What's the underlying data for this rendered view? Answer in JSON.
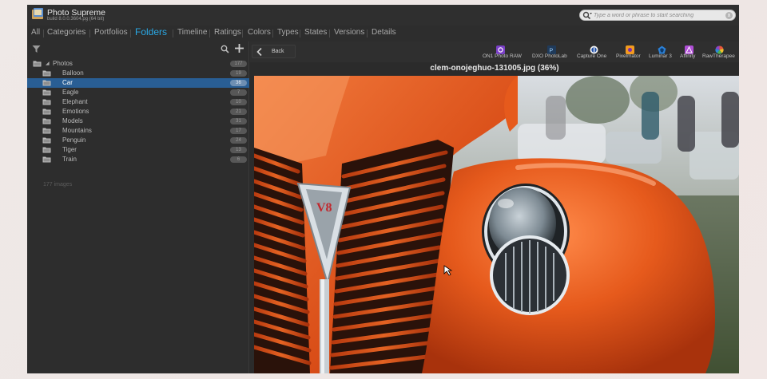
{
  "app": {
    "title": "Photo Supreme",
    "build": "build 8.0.0.3604.pg (64 bit)"
  },
  "search": {
    "placeholder": "Type a word or phrase to start searching",
    "clear_label": "x"
  },
  "tabs": [
    {
      "label": "All",
      "active": false
    },
    {
      "label": "Categories",
      "active": false
    },
    {
      "label": "Portfolios",
      "active": false
    },
    {
      "label": "Folders",
      "active": true
    },
    {
      "label": "Timeline",
      "active": false
    },
    {
      "label": "Ratings",
      "active": false
    },
    {
      "label": "Colors",
      "active": false
    },
    {
      "label": "Types",
      "active": false
    },
    {
      "label": "States",
      "active": false
    },
    {
      "label": "Versions",
      "active": false
    },
    {
      "label": "Details",
      "active": false
    }
  ],
  "folders": {
    "root": {
      "label": "Photos",
      "count": "177",
      "expander": "◢"
    },
    "items": [
      {
        "label": "Balloon",
        "count": "19",
        "selected": false
      },
      {
        "label": "Car",
        "count": "36",
        "selected": true
      },
      {
        "label": "Eagle",
        "count": "7",
        "selected": false
      },
      {
        "label": "Elephant",
        "count": "10",
        "selected": false
      },
      {
        "label": "Emotions",
        "count": "21",
        "selected": false
      },
      {
        "label": "Models",
        "count": "31",
        "selected": false
      },
      {
        "label": "Mountains",
        "count": "17",
        "selected": false
      },
      {
        "label": "Penguin",
        "count": "24",
        "selected": false
      },
      {
        "label": "Tiger",
        "count": "13",
        "selected": false
      },
      {
        "label": "Train",
        "count": "6",
        "selected": false
      }
    ],
    "status": "177 images"
  },
  "viewer": {
    "back_label": "Back",
    "image_title": "clem-onojeghuo-131005.jpg (36%)"
  },
  "plugins": [
    {
      "label": "ON1 Photo RAW",
      "color": "#7a3fc6"
    },
    {
      "label": "DXO PhotoLab",
      "color": "#1f3a5a"
    },
    {
      "label": "Capture One",
      "color": "#f0f0f0"
    },
    {
      "label": "Pixelmator",
      "color": "#f29a1f"
    },
    {
      "label": "Luminar 3",
      "color": "#2b80d6"
    },
    {
      "label": "Affinity",
      "color": "#b04fd6"
    },
    {
      "label": "RawTherapee",
      "color": "#e8563b"
    }
  ],
  "colors": {
    "accent": "#2aa9e6",
    "selection": "#295e94",
    "car_orange": "#e2571b"
  }
}
